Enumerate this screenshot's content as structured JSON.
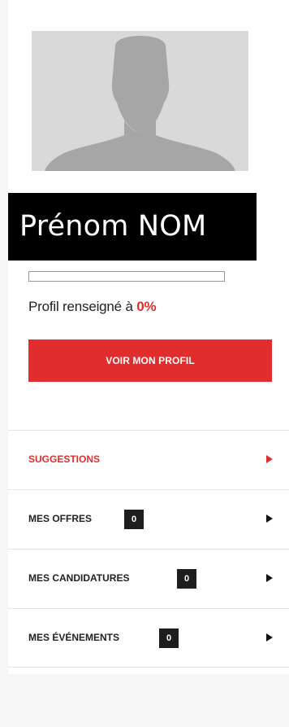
{
  "profile": {
    "avatar_icon": "default-user-silhouette-icon",
    "name": "Prénom NOM",
    "completion_prefix": "Profil renseigné à ",
    "completion_value": "0%",
    "completion_fraction": 0,
    "cta_label": "VOIR MON PROFIL"
  },
  "menu": {
    "items": [
      {
        "label": "SUGGESTIONS",
        "active": true
      },
      {
        "label": "MES OFFRES",
        "count": "0"
      },
      {
        "label": "MES CANDIDATURES",
        "count": "0"
      },
      {
        "label": "MES ÉVÉNEMENTS",
        "count": "0"
      }
    ]
  },
  "colors": {
    "accent": "#e12d2d",
    "badge_bg": "#1e1e1e",
    "avatar_bg": "#d9d9d9",
    "page_bg": "#f6f6f6"
  }
}
